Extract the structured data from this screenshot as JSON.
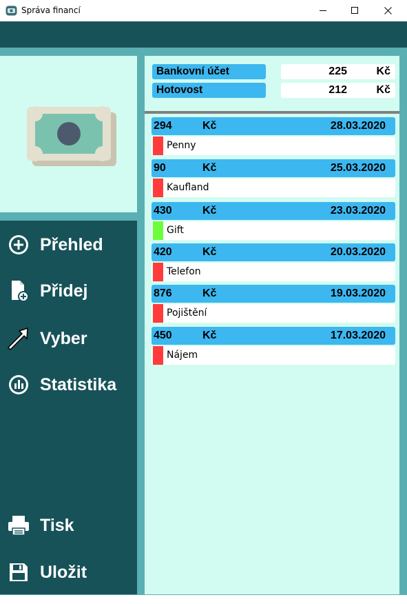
{
  "window": {
    "title": "Správa financí"
  },
  "nav": {
    "items": [
      {
        "label": "Přehled",
        "icon": "plus-circle-icon"
      },
      {
        "label": "Přidej",
        "icon": "file-add-icon"
      },
      {
        "label": "Vyber",
        "icon": "arrow-cursor-icon"
      },
      {
        "label": "Statistika",
        "icon": "stats-circle-icon"
      },
      {
        "label": "Tisk",
        "icon": "printer-icon"
      },
      {
        "label": "Uložit",
        "icon": "floppy-disk-icon"
      }
    ]
  },
  "accounts": [
    {
      "name": "Bankovní účet",
      "amount": "225",
      "currency": "Kč"
    },
    {
      "name": "Hotovost",
      "amount": "212",
      "currency": "Kč"
    }
  ],
  "transactions": [
    {
      "amount": "294",
      "currency": "Kč",
      "date": "28.03.2020",
      "name": "Penny",
      "marker_color": "#ff3b3b"
    },
    {
      "amount": "90",
      "currency": "Kč",
      "date": "25.03.2020",
      "name": "Kaufland",
      "marker_color": "#ff3b3b"
    },
    {
      "amount": "430",
      "currency": "Kč",
      "date": "23.03.2020",
      "name": "Gift",
      "marker_color": "#6bff3b"
    },
    {
      "amount": "420",
      "currency": "Kč",
      "date": "20.03.2020",
      "name": "Telefon",
      "marker_color": "#ff3b3b"
    },
    {
      "amount": "876",
      "currency": "Kč",
      "date": "19.03.2020",
      "name": "Pojištění",
      "marker_color": "#ff3b3b"
    },
    {
      "amount": "450",
      "currency": "Kč",
      "date": "17.03.2020",
      "name": "Nájem",
      "marker_color": "#ff3b3b"
    }
  ],
  "colors": {
    "dark_teal": "#175259",
    "frame_teal": "#5aafb2",
    "panel_mint": "#d2fcf2",
    "header_blue": "#3db7ef",
    "expense_red": "#ff3b3b",
    "income_green": "#6bff3b"
  }
}
